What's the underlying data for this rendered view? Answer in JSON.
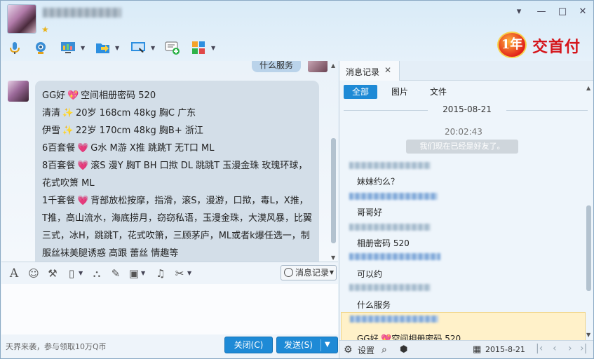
{
  "window": {
    "promo_badge": "1年",
    "promo_text": "交首付",
    "controls": [
      "▾",
      "—",
      "□",
      "✕"
    ]
  },
  "chat": {
    "outgoing_message": "什么服务",
    "incoming_lines": [
      {
        "pre": "GG好",
        "emoji": "heart-icon",
        "post": "空间相册密码 520"
      },
      {
        "pre": "清清",
        "emoji": "sparkle-icon",
        "post": "20岁 168cm  48kg  胸C  广东"
      },
      {
        "pre": "伊雪",
        "emoji": "sparkle-icon",
        "post": "22岁 170cm 48kg  胸B+  浙江"
      },
      {
        "pre": "6百套餐",
        "emoji": "heart-icon",
        "post": "G水 M游 X推 跳跳T 无T口 ML"
      },
      {
        "pre": "8百套餐",
        "emoji": "heart-icon",
        "post": "滚S 漫Y 胸T  BH  口揿 DL  跳跳T   玉漫金珠 玫瑰环球， 花式吹箫 ML"
      },
      {
        "pre": "1千套餐",
        "emoji": "heart-icon",
        "post": "背部放松按摩，指滑，滚S，漫游，口揿，毒L，X推，T推，高山流水，海底捞月，窃窃私语，玉漫金珠，大漠风暴，比翼三式，冰H，跳跳T，花式吹箫，三顾茅庐，ML或者k爆任选一，制服丝袜美腿诱惑 高跟 蕾丝 情趣等"
      }
    ]
  },
  "input_toolbar": {
    "message_record_label": "消息记录"
  },
  "footer": {
    "promo_text": "天界来袭，参与领取10万Q币",
    "close_label": "关闭(C)",
    "send_label": "发送(S)"
  },
  "history": {
    "tab_label": "消息记录",
    "filters": [
      "全部",
      "图片",
      "文件"
    ],
    "date": "2015-08-21",
    "time": "20:02:43",
    "system_message": "我们现在已经是好友了。",
    "messages": [
      "妹妹约么？",
      "哥哥好",
      "相册密码 520",
      "可以约",
      "什么服务"
    ],
    "preview": "GG好",
    "preview_tail": "空间相册密码 520",
    "footer": {
      "settings_label": "设置",
      "date": "2015-8-21"
    }
  }
}
